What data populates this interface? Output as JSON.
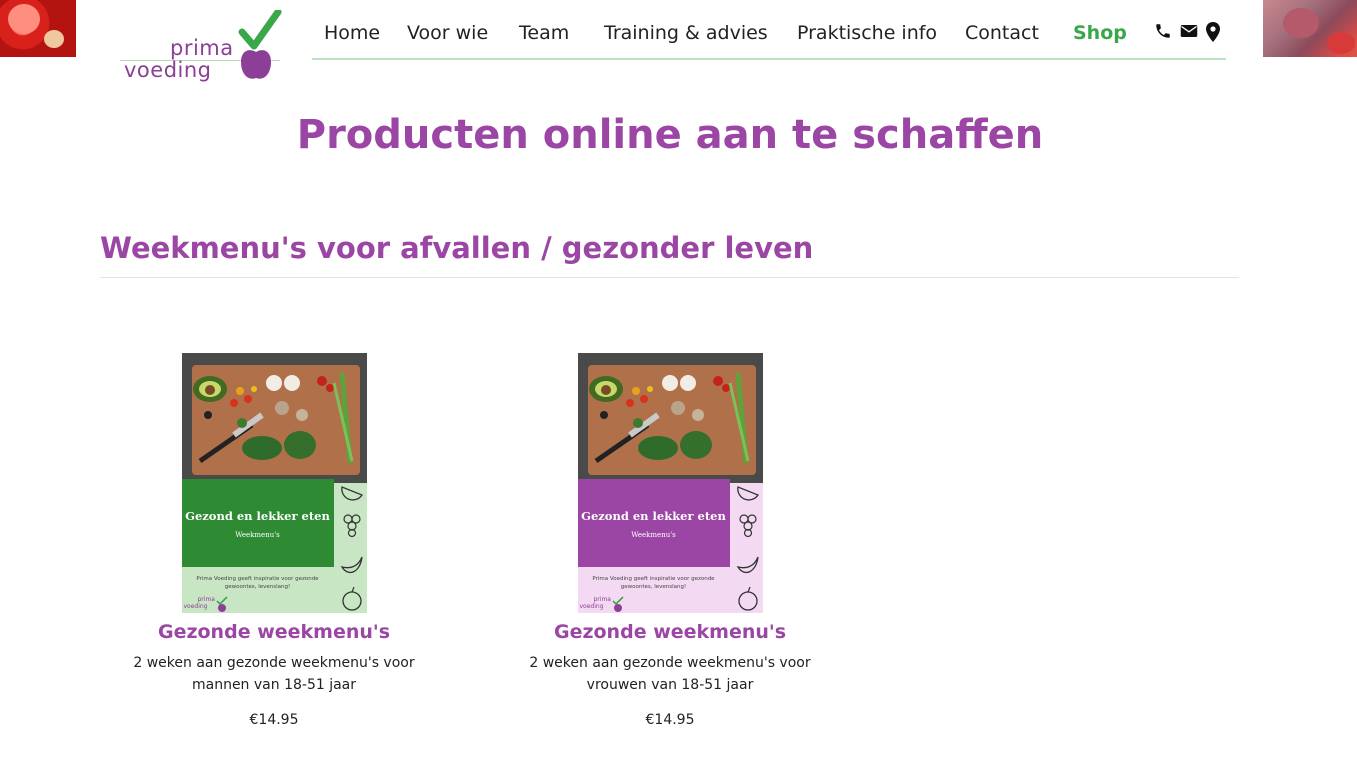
{
  "logo": {
    "word_top": "prima",
    "word_bottom": "voeding"
  },
  "nav": {
    "items": [
      "Home",
      "Voor wie",
      "Team",
      "Training & advies",
      "Praktische info",
      "Contact"
    ],
    "shop_label": "Shop",
    "icons": [
      "phone-icon",
      "envelope-icon",
      "map-marker-icon"
    ]
  },
  "page": {
    "title": "Producten online aan te schaffen"
  },
  "section": {
    "title": "Weekmenu's voor afvallen / gezonder leven"
  },
  "products": [
    {
      "cover_title": "Gezond en lekker eten",
      "cover_subtitle": "Weekmenu's",
      "cover_blurb": "Prima Voeding geeft inspiratie voor gezonde gewoontes, levenslang!",
      "cover_logo_top": "prima",
      "cover_logo_bottom": "voeding",
      "band_color": "#2e8b34",
      "lower_color": "#c8e6c4",
      "name": "Gezonde weekmenu's",
      "description": "2 weken aan gezonde weekmenu's voor mannen van 18-51 jaar",
      "price": "€14.95"
    },
    {
      "cover_title": "Gezond en lekker eten",
      "cover_subtitle": "Weekmenu's",
      "cover_blurb": "Prima Voeding geeft inspiratie voor gezonde gewoontes, levenslang!",
      "cover_logo_top": "prima",
      "cover_logo_bottom": "voeding",
      "band_color": "#9b46a4",
      "lower_color": "#f3d9f1",
      "name": "Gezonde weekmenu's",
      "description": "2 weken aan gezonde weekmenu's voor vrouwen van 18-51 jaar",
      "price": "€14.95"
    }
  ],
  "colors": {
    "brand_purple": "#9b46a4",
    "brand_green": "#3aa84a",
    "nav_rule": "#b9e4bf"
  }
}
